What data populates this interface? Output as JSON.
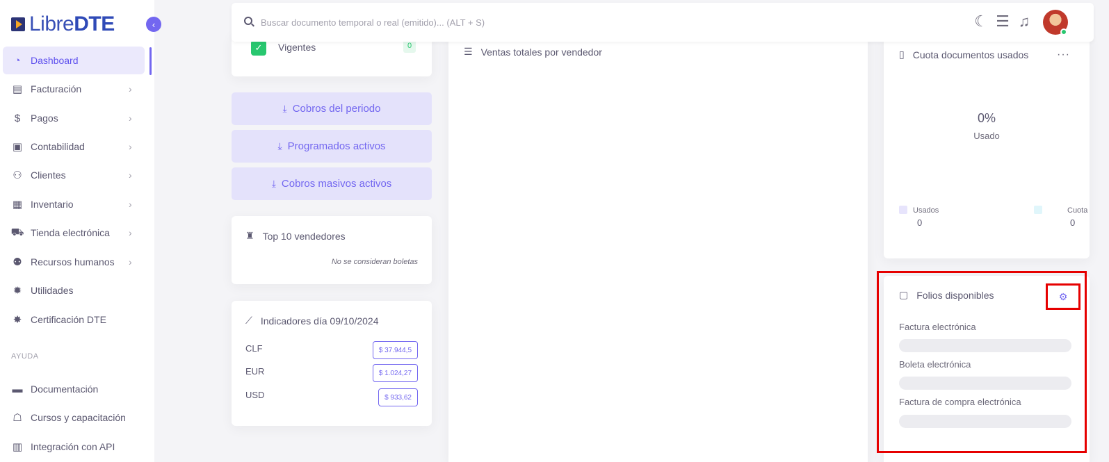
{
  "brand": {
    "name_light": "Libre",
    "name_bold": "DTE"
  },
  "sidebar": {
    "items": [
      {
        "label": "Dashboard",
        "icon": "dashboard-icon",
        "active": true,
        "has_children": false
      },
      {
        "label": "Facturación",
        "icon": "document-icon",
        "has_children": true
      },
      {
        "label": "Pagos",
        "icon": "dollar-icon",
        "has_children": true
      },
      {
        "label": "Contabilidad",
        "icon": "money-icon",
        "has_children": true
      },
      {
        "label": "Clientes",
        "icon": "users-icon",
        "has_children": true
      },
      {
        "label": "Inventario",
        "icon": "boxes-icon",
        "has_children": true
      },
      {
        "label": "Tienda electrónica",
        "icon": "cart-icon",
        "has_children": true
      },
      {
        "label": "Recursos humanos",
        "icon": "people-icon",
        "has_children": true
      },
      {
        "label": "Utilidades",
        "icon": "gear-icon",
        "has_children": false
      },
      {
        "label": "Certificación DTE",
        "icon": "badge-icon",
        "has_children": false
      }
    ],
    "section_label": "AYUDA",
    "help_items": [
      {
        "label": "Documentación",
        "icon": "book-icon"
      },
      {
        "label": "Cursos y capacitación",
        "icon": "teacher-icon"
      },
      {
        "label": "Integración con API",
        "icon": "api-icon"
      }
    ]
  },
  "search": {
    "placeholder": "Buscar documento temporal o real (emitido)... (ALT + S)"
  },
  "left_column": {
    "vigentes": {
      "label": "Vigentes",
      "count": "0"
    },
    "buttons": [
      "Cobros del periodo",
      "Programados activos",
      "Cobros masivos activos"
    ],
    "top_vendedores": {
      "title": "Top 10 vendedores",
      "note": "No se consideran boletas"
    },
    "indicadores": {
      "title": "Indicadores día 09/10/2024",
      "rows": [
        {
          "label": "CLF",
          "value": "$ 37.944,5"
        },
        {
          "label": "EUR",
          "value": "$ 1.024,27"
        },
        {
          "label": "USD",
          "value": "$ 933,62"
        }
      ]
    }
  },
  "center": {
    "ventas_title": "Ventas totales por vendedor"
  },
  "cuota": {
    "title": "Cuota documentos usados",
    "more": "···",
    "percent": "0%",
    "percent_label": "Usado",
    "legend": [
      {
        "label": "Usados",
        "value": "0",
        "color": "#e7e4fc"
      },
      {
        "label": "Cuota",
        "value": "0",
        "color": "#e0f6fb"
      }
    ]
  },
  "folios": {
    "title": "Folios disponibles",
    "items": [
      "Factura electrónica",
      "Boleta electrónica",
      "Factura de compra electrónica"
    ]
  },
  "colors": {
    "accent": "#7367f0",
    "success": "#28c76f",
    "highlight": "#e60000"
  }
}
